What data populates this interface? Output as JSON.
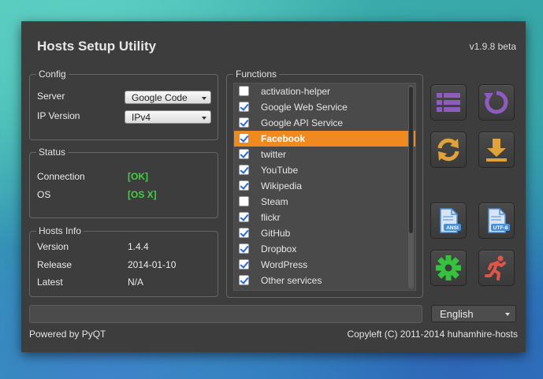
{
  "app": {
    "title": "Hosts Setup Utility",
    "version": "v1.9.8 beta"
  },
  "config": {
    "title": "Config",
    "server_label": "Server",
    "server_value": "Google Code",
    "ip_label": "IP Version",
    "ip_value": "IPv4"
  },
  "status": {
    "title": "Status",
    "connection_label": "Connection",
    "connection_value": "[OK]",
    "os_label": "OS",
    "os_value": "[OS X]"
  },
  "hosts_info": {
    "title": "Hosts Info",
    "version_label": "Version",
    "version_value": "1.4.4",
    "release_label": "Release",
    "release_value": "2014-01-10",
    "latest_label": "Latest",
    "latest_value": "N/A"
  },
  "functions": {
    "title": "Functions",
    "items": [
      {
        "label": "activation-helper",
        "checked": false,
        "selected": false
      },
      {
        "label": "Google Web Service",
        "checked": true,
        "selected": false
      },
      {
        "label": "Google API Service",
        "checked": true,
        "selected": false
      },
      {
        "label": "Facebook",
        "checked": true,
        "selected": true
      },
      {
        "label": "twitter",
        "checked": true,
        "selected": false
      },
      {
        "label": "YouTube",
        "checked": true,
        "selected": false
      },
      {
        "label": "Wikipedia",
        "checked": true,
        "selected": false
      },
      {
        "label": "Steam",
        "checked": false,
        "selected": false
      },
      {
        "label": "flickr",
        "checked": true,
        "selected": false
      },
      {
        "label": "GitHub",
        "checked": true,
        "selected": false
      },
      {
        "label": "Dropbox",
        "checked": true,
        "selected": false
      },
      {
        "label": "WordPress",
        "checked": true,
        "selected": false
      },
      {
        "label": "Other services",
        "checked": true,
        "selected": false
      }
    ]
  },
  "tools": {
    "icons": [
      "list-icon",
      "restore-icon",
      "refresh-icon",
      "download-icon",
      "ansi-file-icon",
      "utf8-file-icon",
      "gear-icon",
      "exit-run-icon"
    ],
    "ansi_text": "ANSI",
    "utf8_text": "UTF-8",
    "colors": {
      "purple": "#8e5bbf",
      "orange": "#e0a33a",
      "green": "#35c23c",
      "red": "#e0554a",
      "blue": "#4a8fd6"
    }
  },
  "language": {
    "value": "English"
  },
  "footer": {
    "powered_by": "Powered by PyQT",
    "copyleft": "Copyleft (C) 2011-2014 huhamhire-hosts"
  }
}
